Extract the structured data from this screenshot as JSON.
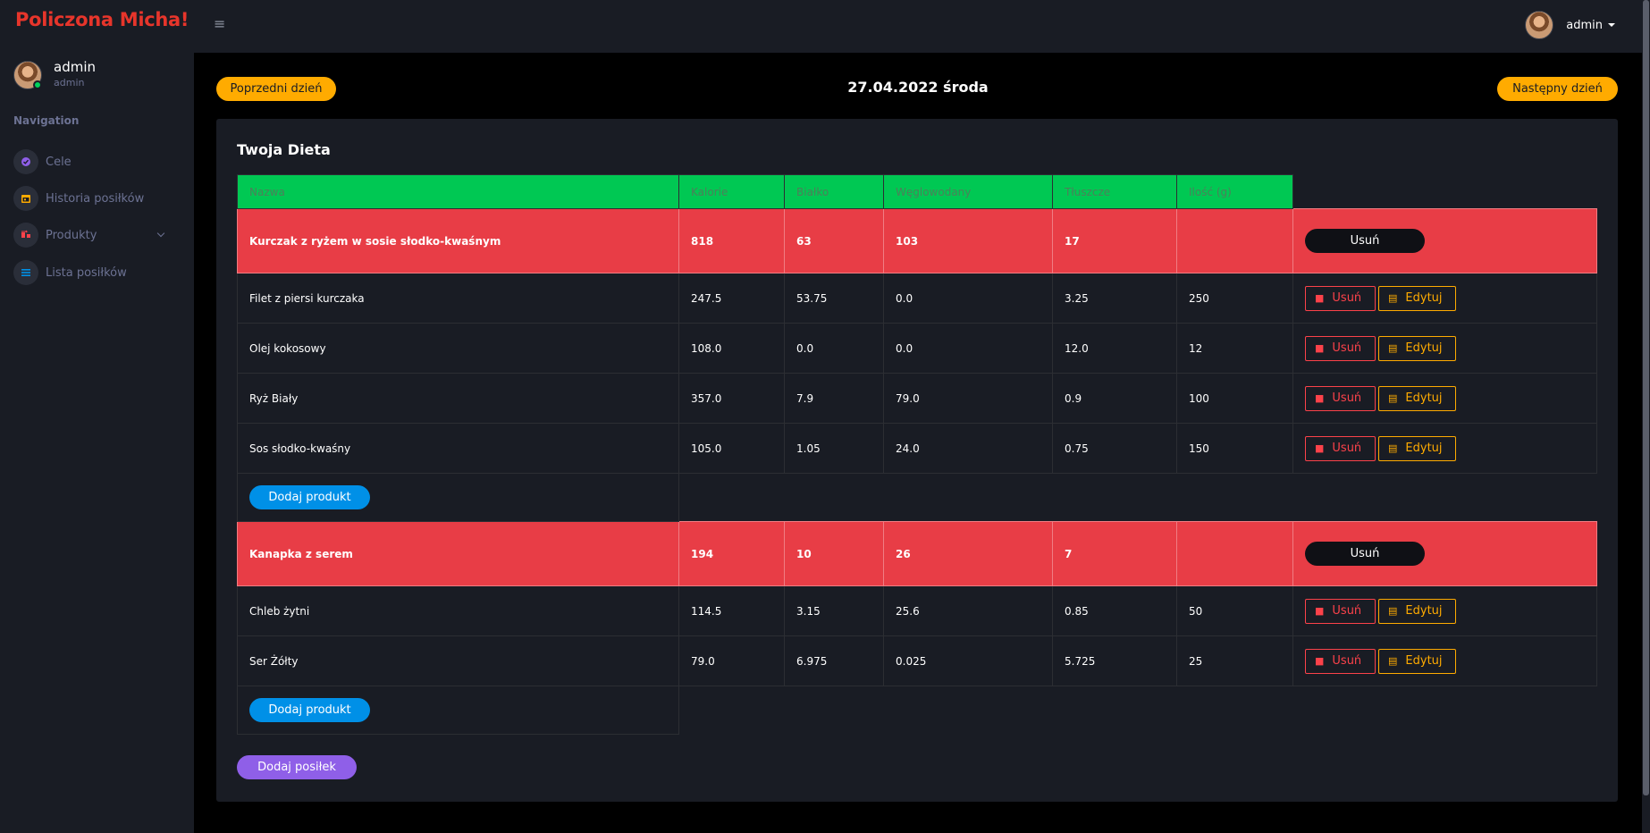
{
  "app": {
    "brand": "Policzona Micha!"
  },
  "sidebar": {
    "profile": {
      "name": "admin",
      "role": "admin"
    },
    "nav_heading": "Navigation",
    "items": [
      {
        "label": "Cele",
        "icon": "target-icon",
        "color": "#8f5fe8"
      },
      {
        "label": "Historia posiłków",
        "icon": "calendar-icon",
        "color": "#ffab00"
      },
      {
        "label": "Produkty",
        "icon": "products-icon",
        "color": "#fc424a"
      },
      {
        "label": "Lista posiłków",
        "icon": "list-icon",
        "color": "#0090e7"
      }
    ]
  },
  "topbar": {
    "user_name": "admin"
  },
  "date_nav": {
    "prev_label": "Poprzedni dzień",
    "date": "27.04.2022 środa",
    "next_label": "Następny dzień"
  },
  "card": {
    "title": "Twoja Dieta",
    "headers": [
      "Nazwa",
      "Kalorie",
      "Białko",
      "Węglowodany",
      "Tłuszcze",
      "Ilość (g)"
    ],
    "meals": [
      {
        "name": "Kurczak z ryżem w sosie słodko-kwaśnym",
        "kcal": "818",
        "protein": "63",
        "carbs": "103",
        "fat": "17",
        "delete_label": "Usuń",
        "products": [
          {
            "name": "Filet z piersi kurczaka",
            "kcal": "247.5",
            "protein": "53.75",
            "carbs": "0.0",
            "fat": "3.25",
            "qty": "250"
          },
          {
            "name": "Olej kokosowy",
            "kcal": "108.0",
            "protein": "0.0",
            "carbs": "0.0",
            "fat": "12.0",
            "qty": "12"
          },
          {
            "name": "Ryż Biały",
            "kcal": "357.0",
            "protein": "7.9",
            "carbs": "79.0",
            "fat": "0.9",
            "qty": "100"
          },
          {
            "name": "Sos słodko-kwaśny",
            "kcal": "105.0",
            "protein": "1.05",
            "carbs": "24.0",
            "fat": "0.75",
            "qty": "150"
          }
        ],
        "add_product_label": "Dodaj produkt"
      },
      {
        "name": "Kanapka z serem",
        "kcal": "194",
        "protein": "10",
        "carbs": "26",
        "fat": "7",
        "delete_label": "Usuń",
        "products": [
          {
            "name": "Chleb żytni",
            "kcal": "114.5",
            "protein": "3.15",
            "carbs": "25.6",
            "fat": "0.85",
            "qty": "50"
          },
          {
            "name": "Ser Żółty",
            "kcal": "79.0",
            "protein": "6.975",
            "carbs": "0.025",
            "fat": "5.725",
            "qty": "25"
          }
        ],
        "add_product_label": "Dodaj produkt"
      }
    ],
    "product_delete_label": "Usuń",
    "product_edit_label": "Edytuj",
    "add_meal_label": "Dodaj posiłek"
  }
}
